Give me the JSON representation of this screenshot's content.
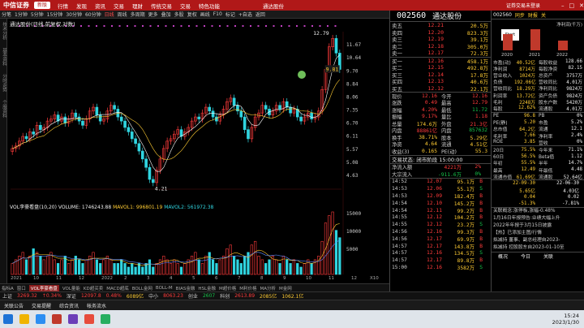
{
  "topbar": {
    "logo": "中信证券",
    "pill": "新版",
    "menu": [
      "行情",
      "发现",
      "资讯",
      "交易",
      "理财",
      "传统交易",
      "交易",
      "特色功能"
    ],
    "center": "通达股份",
    "right": "证券交易未登录"
  },
  "toolbar": {
    "items": [
      "分笔",
      "1分钟",
      "5分钟",
      "15分钟",
      "30分钟",
      "60分钟",
      "日线",
      "周线",
      "多周期",
      "更多",
      "叠加",
      "多股",
      "复权",
      "画线",
      "F10",
      "标记",
      "+自选",
      "返回"
    ],
    "active": "日线"
  },
  "leftstrip": [
    "技术分析",
    "基本资料",
    "分时走势",
    "个股资料"
  ],
  "chart": {
    "title": "通达股份(日线,前复权,对数)",
    "high_label": "12.79",
    "low_label": "4.21",
    "cur_label": "9.81",
    "ticks": [
      "11.67",
      "10.64",
      "9.70",
      "8.84",
      "8.06",
      "7.35",
      "6.70",
      "6.11",
      "5.57",
      "5.08",
      "4.63"
    ],
    "vol_title": "VOL李豪看盘(10,20)",
    "vol_volume": "VOLUME: 1746243.88",
    "vol_mavol1": "MAVOL1: 996801.19",
    "vol_mavol2": "MAVOL2: 561972.38",
    "vol_ticks": [
      "15000",
      "10000",
      "5000"
    ],
    "vol_unit": "X10",
    "months": [
      "2021",
      "10",
      "11",
      "12",
      "2022",
      "2",
      "3",
      "4",
      "5",
      "6",
      "7",
      "8",
      "9",
      "10",
      "11",
      "12"
    ]
  },
  "chart_data": {
    "type": "candlestick",
    "closes": [
      5.6,
      5.7,
      5.9,
      6.1,
      6.0,
      6.3,
      6.2,
      6.6,
      6.4,
      6.5,
      6.8,
      6.9,
      7.1,
      6.8,
      7.0,
      6.7,
      6.9,
      7.2,
      7.0,
      6.8,
      6.6,
      6.9,
      7.3,
      7.5,
      7.1,
      6.8,
      6.9,
      7.3,
      7.6,
      7.4,
      7.0,
      6.8,
      6.5,
      6.3,
      6.0,
      5.8,
      5.5,
      5.2,
      4.9,
      4.5,
      4.4,
      4.8,
      5.2,
      5.6,
      5.9,
      6.0,
      6.2,
      6.4,
      6.1,
      6.3,
      6.5,
      6.8,
      7.0,
      6.9,
      7.2,
      7.5,
      7.3,
      7.0,
      6.8,
      7.1,
      7.4,
      7.8,
      8.0,
      7.6,
      7.3,
      7.0,
      6.4,
      6.0,
      6.5,
      7.0,
      7.2,
      7.6,
      7.4,
      7.1,
      7.3,
      7.6,
      7.4,
      7.8,
      7.5,
      7.2,
      7.4,
      7.0,
      6.8,
      7.0,
      7.2,
      6.9,
      7.0,
      7.3,
      8.5,
      9.8,
      11.5,
      12.2,
      11.0,
      9.8
    ],
    "volumes": [
      3,
      4,
      5,
      6,
      4,
      5,
      7,
      6,
      5,
      4,
      5,
      6,
      4,
      3,
      4,
      5,
      3,
      4,
      5,
      4,
      3,
      4,
      5,
      6,
      4,
      3,
      4,
      5,
      4,
      3,
      3,
      4,
      3,
      2,
      3,
      2,
      3,
      2,
      3,
      4,
      2,
      3,
      4,
      5,
      4,
      3,
      4,
      3,
      2,
      3,
      4,
      5,
      6,
      4,
      3,
      5,
      6,
      4,
      3,
      4,
      5,
      7,
      8,
      5,
      4,
      3,
      5,
      6,
      8,
      9,
      5,
      4,
      3,
      4,
      5,
      4,
      3,
      5,
      4,
      3,
      4,
      3,
      2,
      3,
      4,
      3,
      4,
      5,
      9,
      14,
      16,
      17,
      12,
      10
    ],
    "ylim": [
      4.2,
      12.8
    ]
  },
  "quote": {
    "code": "002560",
    "name": "通达股份",
    "sells": [
      {
        "l": "卖五",
        "p": "12.21",
        "v": "20.5万"
      },
      {
        "l": "卖四",
        "p": "12.20",
        "v": "823.3万"
      },
      {
        "l": "卖三",
        "p": "12.19",
        "v": "39.1万"
      },
      {
        "l": "卖二",
        "p": "12.18",
        "v": "305.0万"
      },
      {
        "l": "卖一",
        "p": "12.17",
        "v": "72.3万"
      }
    ],
    "buys": [
      {
        "l": "买一",
        "p": "12.16",
        "v": "458.1万"
      },
      {
        "l": "买二",
        "p": "12.15",
        "v": "492.8万"
      },
      {
        "l": "买三",
        "p": "12.14",
        "v": "17.8万"
      },
      {
        "l": "买四",
        "p": "12.13",
        "v": "40.6万"
      },
      {
        "l": "买五",
        "p": "12.12",
        "v": "22.1万"
      }
    ],
    "stats": [
      [
        "现价",
        "12.16",
        "今开",
        "12.16"
      ],
      [
        "涨跌",
        "0.49",
        "最高",
        "12.79"
      ],
      [
        "涨幅",
        "4.20%",
        "最低",
        "11.72"
      ],
      [
        "振幅",
        "9.17%",
        "量比",
        "1.18"
      ],
      [
        "总量",
        "174.6万",
        "外盘",
        "21.3亿"
      ],
      [
        "内盘",
        "88861亿",
        "内盘",
        "857632"
      ],
      [
        "换手",
        "38.71%",
        "股本",
        "5.29亿"
      ],
      [
        "净资",
        "4.64",
        "流通",
        "4.51亿"
      ],
      [
        "收益(3)",
        "0.165",
        "PE(动)",
        "55.3"
      ]
    ],
    "trade_state": "交易状态: 闭市阶段 15:00:00",
    "flow": [
      [
        "净流入额",
        "4221万",
        "2%"
      ],
      [
        "大宗流入",
        "-911.6万",
        "0%"
      ]
    ],
    "ticks": [
      [
        "12.07",
        "95.1万",
        "B"
      ],
      [
        "12.06",
        "55.1万",
        "S"
      ],
      [
        "12.09",
        "182.4万",
        "B"
      ],
      [
        "12.10",
        "145.2万",
        "B"
      ],
      [
        "12.11",
        "99.2万",
        "B"
      ],
      [
        "12.12",
        "104.2万",
        "B"
      ],
      [
        "12.12",
        "23.2万",
        "S"
      ],
      [
        "12.16",
        "99.3万",
        "B"
      ],
      [
        "12.17",
        "69.9万",
        "B"
      ],
      [
        "12.17",
        "143.8万",
        "B"
      ],
      [
        "12.16",
        "134.5万",
        "S"
      ],
      [
        "12.17",
        "89.8万",
        "B"
      ],
      [
        "12.16",
        "3582万",
        "S"
      ]
    ],
    "tick_times": [
      "14:52",
      "14:53",
      "14:53",
      "14:54",
      "14:54",
      "14:55",
      "14:55",
      "14:56",
      "14:56",
      "14:57",
      "14:57",
      "14:57",
      "15:00"
    ]
  },
  "f10": {
    "code": "002560",
    "tabs": [
      "同步",
      "财报",
      "关"
    ],
    "profit_label": "净利润(千万)",
    "years": [
      "2020",
      "2021",
      "2022"
    ],
    "rows": [
      [
        "市盈(动)",
        "40.52亿",
        "每股收益",
        "128.66"
      ],
      [
        "净利润",
        "8714万",
        "每股净资",
        "82.15"
      ],
      [
        "营业收入",
        "1024万",
        "总资产",
        "3757万"
      ],
      [
        "负债",
        "192.06亿",
        "营收同比",
        "4.01万"
      ],
      [
        "营收同比",
        "18.29万",
        "净利同比",
        "9824万"
      ],
      [
        "利润率",
        "13.72亿",
        "资产负债",
        "9824万"
      ],
      [
        "毛利",
        "2248万",
        "股东户数",
        "5420万"
      ],
      [
        "每股",
        "12.62%",
        "流通股",
        "4.01万"
      ]
    ],
    "rows2": [
      [
        "PE",
        "96.8",
        "PB",
        "0%"
      ],
      [
        "PE(静)",
        "5.20",
        "市盈",
        "5.2%"
      ],
      [
        "总市值",
        "64.2亿",
        "流通",
        "12.1"
      ],
      [
        "毛利率",
        "7.66",
        "净利率",
        "2.4%"
      ],
      [
        "ROE",
        "3.85",
        "营收",
        "0%"
      ]
    ],
    "rows3": [
      [
        "20日",
        "75.5%",
        "今年来",
        "71.1%"
      ],
      [
        "60日",
        "56.5%",
        "Beta值",
        "1.12"
      ],
      [
        "年初",
        "55.5%",
        "半年",
        "14.7%"
      ],
      [
        "最高",
        "12.49",
        "年最低",
        "4.48"
      ],
      [
        "流通市值",
        "61.69亿",
        "流通股",
        "52.64亿"
      ]
    ],
    "rows4": [
      [
        "22-09-30",
        "22-06-30"
      ],
      [
        "5.65亿",
        "4.03亿"
      ],
      [
        "0.04",
        "0.02"
      ],
      [
        "-51.3%",
        "-7.81%"
      ]
    ],
    "concept": "关联概念:涨停板,涨幅-0.48%",
    "news": [
      "1月16日年报预告:业绩大幅上升",
      "2022年年报于3月15日披露",
      "【热】已添加主图/行情",
      "拟减持 董事、副总经理自2023-",
      "拟减持 控股股东自2023-01-10至"
    ],
    "bottom_tabs": [
      "概况",
      "今日",
      "关联"
    ]
  },
  "bottom_tabs": [
    "指标A",
    "窗口",
    "VOL李豪看盘",
    "VOL量能",
    "KD超买卖",
    "MACD超底",
    "BOLL金网",
    "BOLL-M",
    "BIAS金融",
    "HSL金融",
    "M超价格",
    "M利价格",
    "MA分析",
    "M金网"
  ],
  "statusbar": [
    {
      "t": "上证",
      "c": "#ccc"
    },
    {
      "t": "3269.32",
      "c": "#ff3b3b"
    },
    {
      "t": "↑0.34%",
      "c": "#ff3b3b"
    },
    {
      "t": "深证",
      "c": "#ccc"
    },
    {
      "t": "12097.8",
      "c": "#ff3b3b"
    },
    {
      "t": "0.48%",
      "c": "#ff3b3b"
    },
    {
      "t": "6089亿",
      "c": "#ffcc33"
    },
    {
      "t": "中小",
      "c": "#ccc"
    },
    {
      "t": "8063.23",
      "c": "#ff3b3b"
    },
    {
      "t": "创业",
      "c": "#ccc"
    },
    {
      "t": "2607",
      "c": "#16c24a"
    },
    {
      "t": "科创",
      "c": "#ccc"
    },
    {
      "t": "2613.89",
      "c": "#ff3b3b"
    },
    {
      "t": "2085亿",
      "c": "#ffcc33"
    },
    {
      "t": "1062.1亿",
      "c": "#ffcc33"
    }
  ],
  "msgbar": [
    "关联公告",
    "交易提醒",
    "综合资讯",
    "帐务流水"
  ],
  "taskbar": {
    "time": "15:24",
    "date": "2023/1/30"
  },
  "colors": {
    "red": "#ff3b3b",
    "green": "#16c24a",
    "yellow": "#ffcc33",
    "brand": "#b01818"
  }
}
